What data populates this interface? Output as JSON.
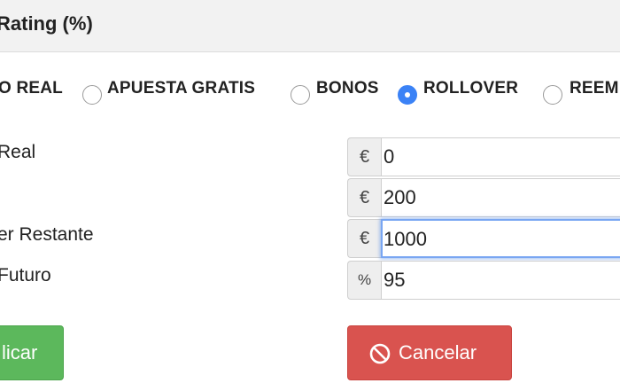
{
  "header": {
    "title": "Rating (%)"
  },
  "bet_type": {
    "options": [
      {
        "label": "O REAL",
        "checked": false
      },
      {
        "label": "APUESTA GRATIS",
        "checked": false
      },
      {
        "label": "BONOS",
        "checked": false
      },
      {
        "label": "ROLLOVER",
        "checked": true
      },
      {
        "label": "REEM",
        "checked": false
      }
    ]
  },
  "fields": [
    {
      "label": "Real",
      "addon": "€",
      "value": "0"
    },
    {
      "label": "",
      "addon": "€",
      "value": "200"
    },
    {
      "label": "er Restante",
      "addon": "€",
      "value": "1000"
    },
    {
      "label": "Futuro",
      "addon": "%",
      "value": "95"
    }
  ],
  "buttons": {
    "apply_label": "licar",
    "cancel_label": "Cancelar"
  },
  "colors": {
    "apply": "#5cb85c",
    "cancel": "#d9534f",
    "radio_checked": "#3b82f6",
    "focus": "#79a6f2"
  },
  "icons": {
    "cancel": "ban-icon"
  }
}
